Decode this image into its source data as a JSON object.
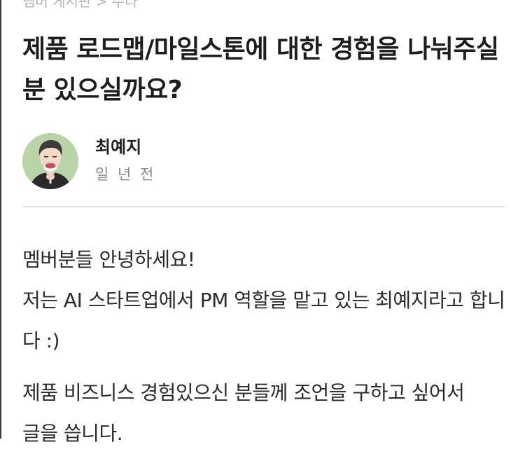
{
  "breadcrumb": "멤버 게시판 > 수다",
  "post": {
    "title": "제품 로드맵/마일스톤에 대한 경험을 나눠주실 분 있으실까요?",
    "author": {
      "name": "최예지",
      "time": "일 년 전"
    },
    "body": {
      "line1": "멤버분들 안녕하세요!",
      "line2": "저는 AI 스타트업에서 PM 역할을 맡고 있는 최예지라고 합니다 :)",
      "line3": "제품 비즈니스 경험있으신 분들께 조언을 구하고 싶어서",
      "line4": "글을 씁니다."
    }
  },
  "colors": {
    "avatar_bg": "#b9d4a7",
    "divider": "#e3e3e3",
    "meta_text": "#8a8a8a"
  },
  "icons": {
    "avatar": "memoji-avatar-icon"
  }
}
